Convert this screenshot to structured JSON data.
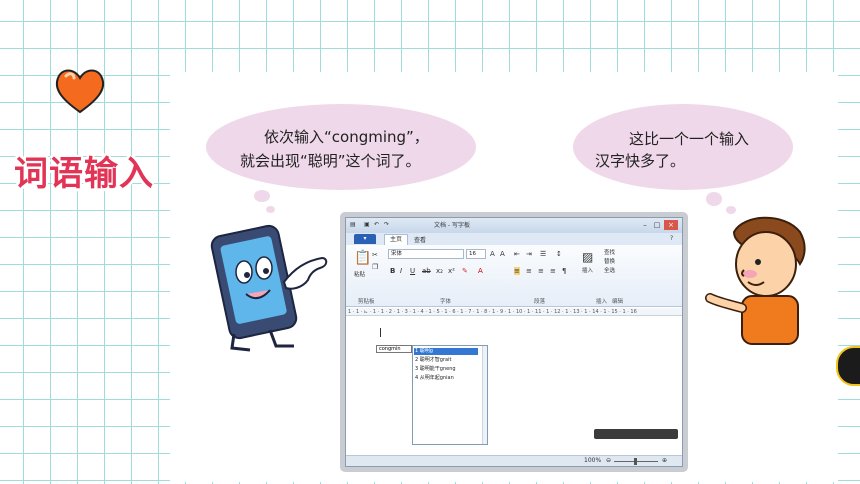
{
  "title": "词语输入",
  "bubble_left": {
    "line1": "依次输入“congming”，",
    "line2": "就会出现“聪明”这个词了。"
  },
  "bubble_right": {
    "line1": "这比一个一个输入",
    "line2": "汉字快多了。"
  },
  "window": {
    "title": "文档 - 写字板",
    "file_tab": "▾",
    "tabs": [
      "主页",
      "查看"
    ],
    "font_name": "宋体",
    "font_size": "16",
    "groups": [
      "剪贴板",
      "字体",
      "段落",
      "插入",
      "编辑"
    ],
    "paste_label": "粘贴",
    "insert_label": "插入",
    "find_label": "查找",
    "replace_label": "替换",
    "select_all_label": "全选",
    "ruler": "1 · 1 · ⊾ · 1 · 1 · 2 · 1 · 3 · 1 · 4 · 1 · 5 · 1 · 6 · 1 · 7 · 1 · 8 · 1 · 9 · 1 · 10 · 1 · 11 · 1 · 12 · 1 · 13 · 1 · 14 · 1 · 15 · 1 · 16",
    "composition": "congmin",
    "candidates": [
      "1 聪明g",
      "2 聪明才智grait",
      "3 聪明能干gneng",
      "4 从明年起gnian"
    ],
    "zoom": "100%"
  },
  "colors": {
    "title": "#e23456",
    "bubble": "#efd8ea",
    "grid": "#9fdcdc"
  }
}
